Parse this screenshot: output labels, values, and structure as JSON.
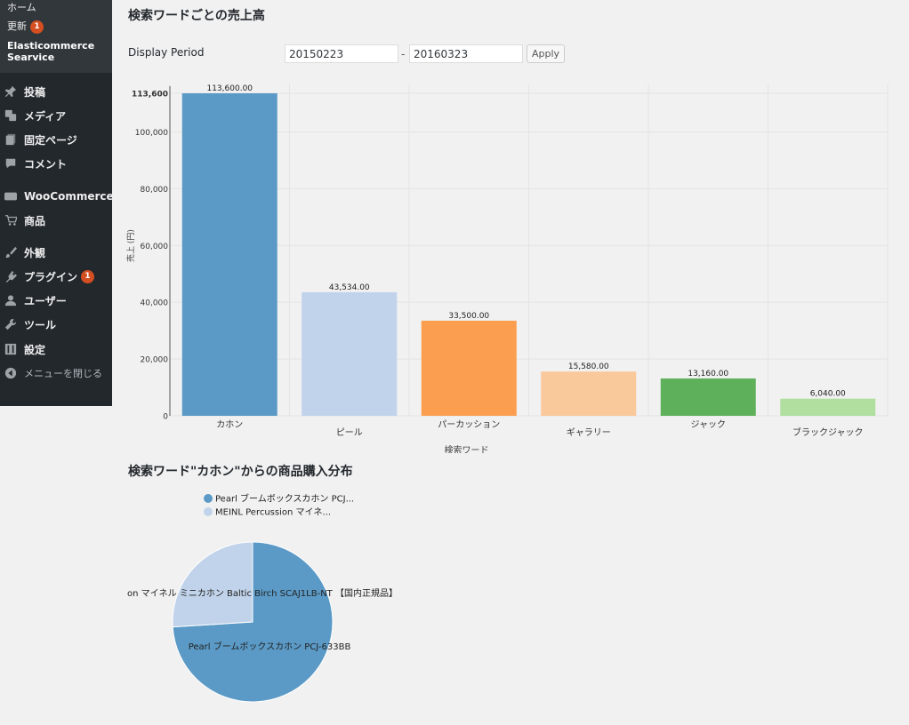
{
  "sidebar": {
    "submenu": [
      {
        "label": "ホーム"
      },
      {
        "label": "更新",
        "badge": "1"
      }
    ],
    "plugin_title": "Elasticommerce Searvice",
    "items": [
      {
        "label": "投稿",
        "icon": "pin-icon"
      },
      {
        "label": "メディア",
        "icon": "media-icon"
      },
      {
        "label": "固定ページ",
        "icon": "page-icon"
      },
      {
        "label": "コメント",
        "icon": "comment-icon"
      },
      {
        "label": "WooCommerce",
        "icon": "woo-icon"
      },
      {
        "label": "商品",
        "icon": "cart-icon"
      },
      {
        "label": "外観",
        "icon": "brush-icon"
      },
      {
        "label": "プラグイン",
        "icon": "plugin-icon",
        "badge": "1"
      },
      {
        "label": "ユーザー",
        "icon": "user-icon"
      },
      {
        "label": "ツール",
        "icon": "wrench-icon"
      },
      {
        "label": "設定",
        "icon": "settings-icon"
      },
      {
        "label": "メニューを閉じる",
        "icon": "collapse-icon"
      }
    ]
  },
  "main": {
    "title": "検索ワードごとの売上高",
    "period": {
      "label": "Display Period",
      "from": "20150223",
      "separator": "-",
      "to": "20160323",
      "apply_label": "Apply"
    },
    "pie_title": "検索ワード\"カホン\"からの商品購入分布"
  },
  "colors": {
    "accent": "#d54e21",
    "sidebar_bg": "#23282d"
  },
  "chart_data": [
    {
      "type": "bar",
      "categories": [
        "カホン",
        "ピール",
        "パーカッション",
        "ギャラリー",
        "ジャック",
        "ブラックジャック"
      ],
      "values": [
        113600,
        43534,
        33500,
        15580,
        13160,
        6040
      ],
      "value_labels": [
        "113,600.00",
        "43,534.00",
        "33,500.00",
        "15,580.00",
        "13,160.00",
        "6,040.00"
      ],
      "colors": [
        "#5b9ac6",
        "#c0d3ea",
        "#fb9e4f",
        "#f9c89b",
        "#5fb05a",
        "#b0dfa0"
      ],
      "ylabel": "売上 (円)",
      "xlabel": "検索ワード",
      "ylim": [
        0,
        113600
      ],
      "yticks": [
        0,
        20000,
        40000,
        60000,
        80000,
        100000,
        113600
      ],
      "ytick_labels": [
        "0",
        "20,000",
        "40,000",
        "60,000",
        "80,000",
        "100,000",
        "113,600"
      ],
      "grid": true
    },
    {
      "type": "pie",
      "series": [
        {
          "name": "Pearl ブームボックスカホン PCJ...",
          "label": "Pearl ブームボックスカホン PCJ-633BB",
          "value": 74,
          "color": "#5b9ac6"
        },
        {
          "name": "MEINL Percussion マイネ...",
          "label": "on マイネル ミニカホン Baltic Birch SCAJ1LB-NT 【国内正規品】",
          "value": 26,
          "color": "#c0d3ea"
        }
      ],
      "legend": "top"
    }
  ]
}
